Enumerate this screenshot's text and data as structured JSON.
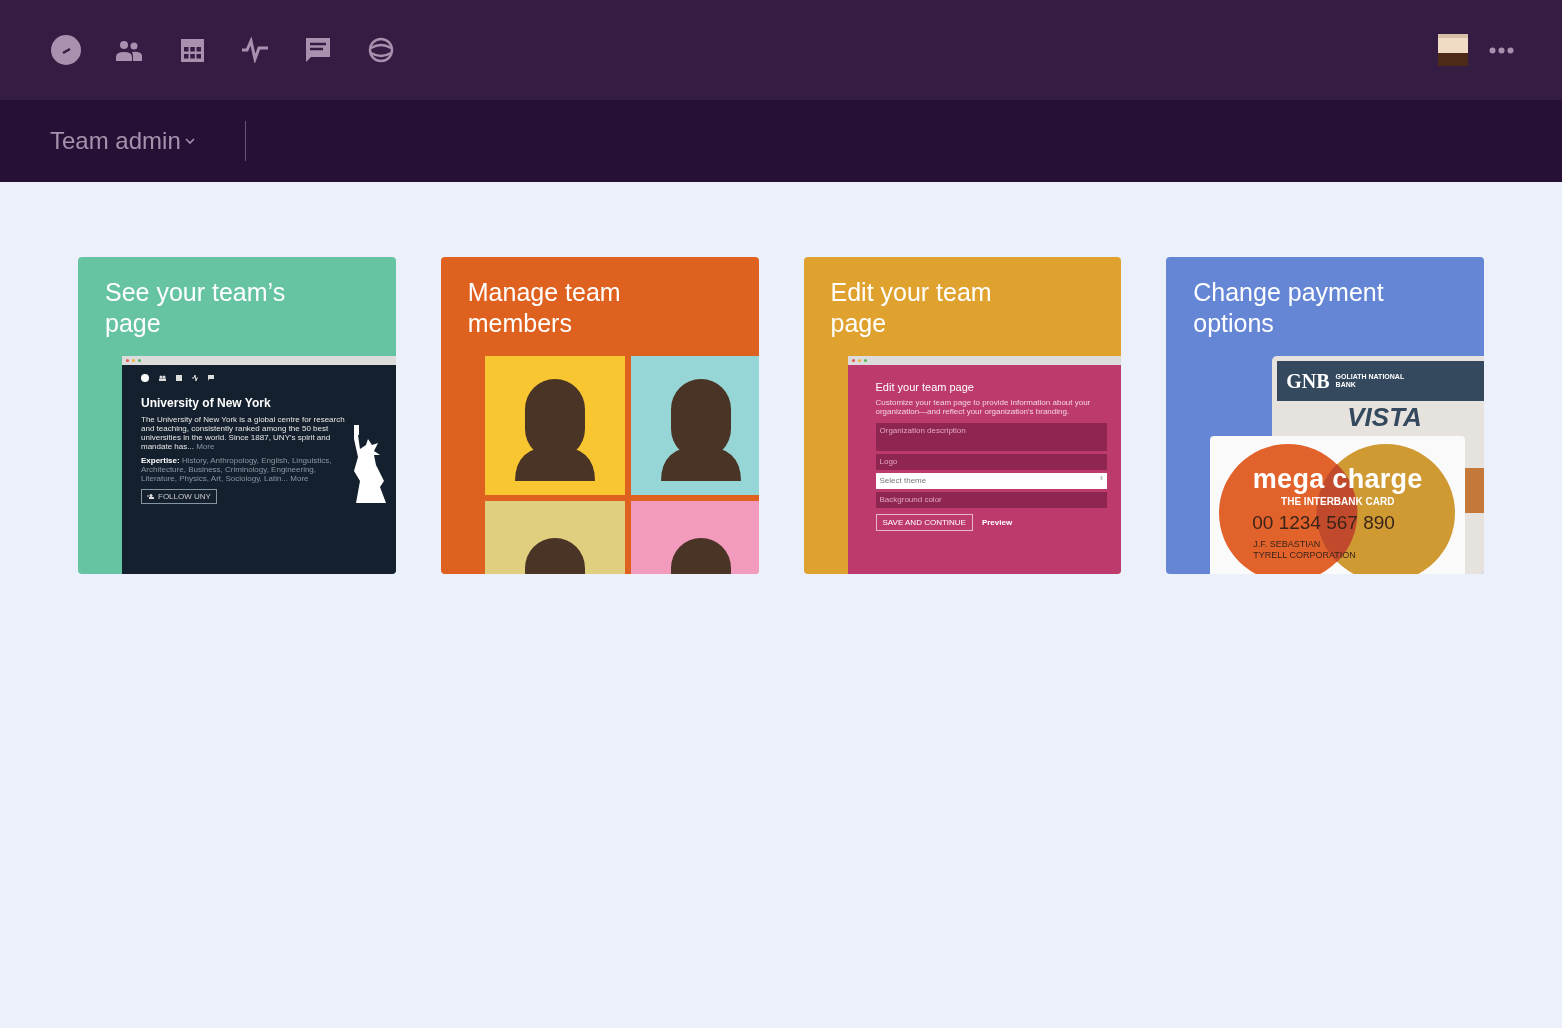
{
  "header": {
    "section": "Team admin"
  },
  "cards": [
    {
      "kind": "university",
      "title": "See your team’s page",
      "preview": {
        "name": "University of New York",
        "description": "The University of New York is a global centre for research and teaching, consistently ranked among the 50 best universities in the world. Since 1887, UNY's spirit and mandate has...",
        "more": "More",
        "expertise_label": "Expertise:",
        "expertise": "History, Anthropology, English, Linguistics, Architecture, Business, Criminology, Engineering, Literature, Physics, Art, Sociology, Latin...",
        "expertise_more": "More",
        "follow": "FOLLOW UNY"
      }
    },
    {
      "kind": "members",
      "title": "Manage team members",
      "preview": {
        "tiles": [
          {
            "color": "#f8c630"
          },
          {
            "color": "#97d6d6"
          },
          {
            "color": "#e0cf7e"
          },
          {
            "color": "#f29bbd"
          }
        ]
      }
    },
    {
      "kind": "editor",
      "title": "Edit your team page",
      "preview": {
        "heading": "Edit your team page",
        "description": "Customize your team page to provide information about your organization—and reflect your organization's branding.",
        "fields": [
          {
            "kind": "textarea",
            "placeholder": "Organization description"
          },
          {
            "kind": "text",
            "placeholder": "Logo"
          },
          {
            "kind": "select",
            "placeholder": "Select theme"
          },
          {
            "kind": "text",
            "placeholder": "Background color"
          }
        ],
        "save": "SAVE AND CONTINUE",
        "preview_link": "Preview"
      }
    },
    {
      "kind": "payment",
      "title": "Change payment options",
      "preview": {
        "bank_code": "GNB",
        "bank_name": "GOLIATH NATIONAL BANK",
        "back_brand": "VISTA",
        "brand": "mega charge",
        "tagline": "THE INTERBANK CARD",
        "number": "00 1234 567 890",
        "holder": "J.F. SEBASTIAN",
        "company": "TYRELL CORPORATION"
      }
    }
  ]
}
